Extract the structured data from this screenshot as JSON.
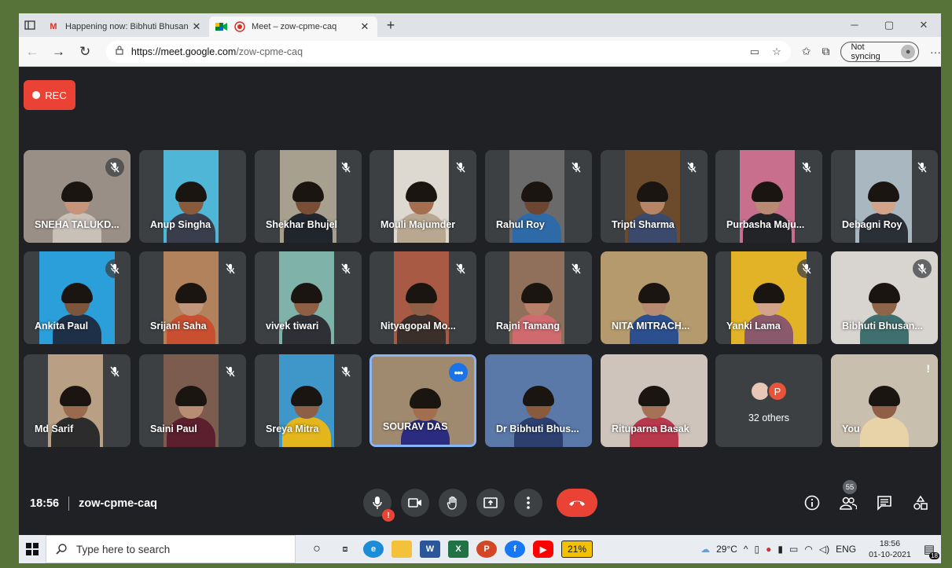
{
  "browser": {
    "tabs": [
      {
        "title": "Happening now: Bibhuti Bhusan",
        "favicon": "gmail-icon",
        "active": false
      },
      {
        "title": "Meet – zow-cpme-caq",
        "favicon": "meet-icon",
        "active": true
      }
    ],
    "url_host": "https://meet.google.com",
    "url_path": "/zow-cpme-caq",
    "sync_label": "Not syncing"
  },
  "meet": {
    "rec_label": "REC",
    "time": "18:56",
    "meeting_code": "zow-cpme-caq",
    "participants_count": "55",
    "others_label": "32 others",
    "others_avatar_letter": "P",
    "participants": [
      {
        "name": "SNEHA TALUKD...",
        "muted": true
      },
      {
        "name": "Anup Singha",
        "muted": false
      },
      {
        "name": "Shekhar Bhujel",
        "muted": true
      },
      {
        "name": "Mouli Majumder",
        "muted": true
      },
      {
        "name": "Rahul Roy",
        "muted": true
      },
      {
        "name": "Tripti Sharma",
        "muted": true
      },
      {
        "name": "Purbasha Maju...",
        "muted": true
      },
      {
        "name": "Debagni Roy",
        "muted": true
      },
      {
        "name": "Ankita Paul",
        "muted": true
      },
      {
        "name": "Srijani Saha",
        "muted": true
      },
      {
        "name": "vivek tiwari",
        "muted": true
      },
      {
        "name": "Nityagopal Mo...",
        "muted": true
      },
      {
        "name": "Rajni Tamang",
        "muted": true
      },
      {
        "name": "NITA MITRACH...",
        "muted": false
      },
      {
        "name": "Yanki Lama",
        "muted": true
      },
      {
        "name": "Bibhuti Bhusan...",
        "muted": true
      },
      {
        "name": "Md Sarif",
        "muted": true
      },
      {
        "name": "Saini Paul",
        "muted": true
      },
      {
        "name": "Sreya Mitra",
        "muted": true
      },
      {
        "name": "SOURAV DAS",
        "muted": false
      },
      {
        "name": "Dr Bibhuti Bhus...",
        "muted": false
      },
      {
        "name": "Rituparna Basak",
        "muted": false
      },
      {
        "name": "You",
        "muted": false
      }
    ]
  },
  "taskbar": {
    "search_placeholder": "Type here to search",
    "battery_pct": "21%",
    "temperature": "29°C",
    "language": "ENG",
    "clock_time": "18:56",
    "clock_date": "01-10-2021",
    "notif_count": "18"
  },
  "colors": {
    "meet_bg": "#202124",
    "tile_bg": "#3c4043",
    "hangup": "#ea4335",
    "rec": "#ea4335",
    "speaking_border": "#8ab4f8"
  }
}
